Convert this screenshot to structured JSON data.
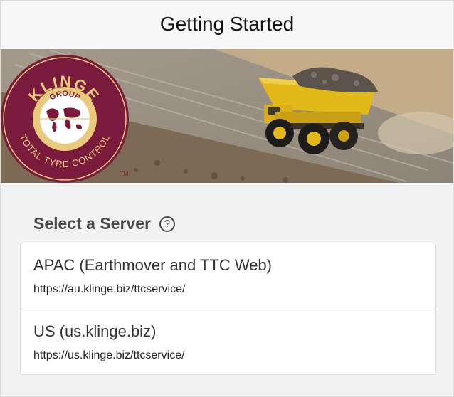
{
  "header": {
    "title": "Getting Started"
  },
  "banner": {
    "logo": {
      "brand_text": "KLINGE",
      "group_text": "GROUP",
      "tagline_text": "TOTAL TYRE CONTROL",
      "trademark": "TM"
    },
    "colors": {
      "logo_maroon": "#7a1a3c",
      "logo_gold": "#e9c97a",
      "truck_yellow": "#e3b91a"
    }
  },
  "server_section": {
    "title": "Select a Server",
    "help_icon": "question-circle-icon",
    "servers": [
      {
        "name": "APAC (Earthmover and TTC Web)",
        "url": "https://au.klinge.biz/ttcservice/"
      },
      {
        "name": "US (us.klinge.biz)",
        "url": "https://us.klinge.biz/ttcservice/"
      }
    ]
  }
}
